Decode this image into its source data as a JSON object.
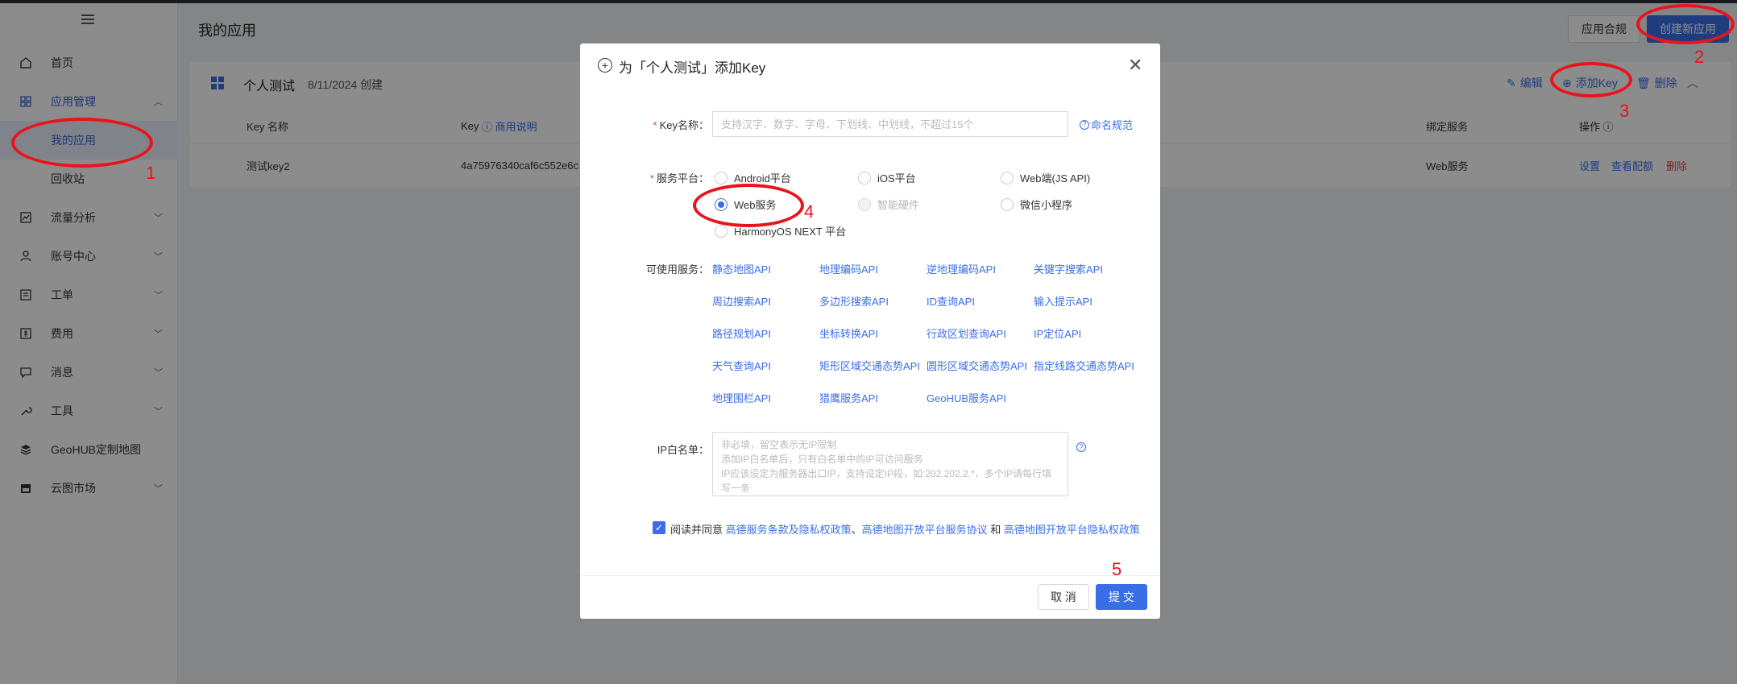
{
  "sidebar": {
    "items": [
      {
        "label": "首页",
        "icon": "home-icon"
      },
      {
        "label": "应用管理",
        "icon": "grid-icon"
      },
      {
        "label": "我的应用"
      },
      {
        "label": "回收站"
      },
      {
        "label": "流量分析",
        "icon": "chart-icon"
      },
      {
        "label": "账号中心",
        "icon": "user-icon"
      },
      {
        "label": "工单",
        "icon": "ticket-icon"
      },
      {
        "label": "费用",
        "icon": "wallet-icon"
      },
      {
        "label": "消息",
        "icon": "message-icon"
      },
      {
        "label": "工具",
        "icon": "wrench-icon"
      },
      {
        "label": "GeoHUB定制地图",
        "icon": "layers-icon"
      },
      {
        "label": "云图市场",
        "icon": "store-icon"
      }
    ]
  },
  "header": {
    "title": "我的应用",
    "compliance_label": "应用合规",
    "create_label": "创建新应用"
  },
  "app": {
    "name": "个人测试",
    "created": "8/11/2024 创建",
    "actions": {
      "edit": "编辑",
      "add_key": "添加Key",
      "delete": "删除"
    },
    "columns": {
      "key_name": "Key 名称",
      "key": "Key",
      "biz": "商用说明",
      "service": "绑定服务",
      "ops": "操作"
    },
    "row": {
      "key_name": "测试key2",
      "key": "4a75976340caf6c552e6c",
      "service": "Web服务",
      "settings": "设置",
      "config": "查看配额",
      "delete": "删除"
    }
  },
  "modal": {
    "title": "为「个人测试」添加Key",
    "key_name_label": "Key名称：",
    "key_name_placeholder": "支持汉字、数字、字母、下划线、中划线，不超过15个",
    "naming_rule": "命名规范",
    "platform_label": "服务平台：",
    "platforms": [
      "Android平台",
      "iOS平台",
      "Web端(JS API)",
      "Web服务",
      "智能硬件",
      "微信小程序",
      "HarmonyOS NEXT 平台"
    ],
    "selected_platform": "Web服务",
    "services_label": "可使用服务：",
    "services": [
      "静态地图API",
      "地理编码API",
      "逆地理编码API",
      "关键字搜索API",
      "周边搜索API",
      "多边形搜索API",
      "ID查询API",
      "输入提示API",
      "路径规划API",
      "坐标转换API",
      "行政区划查询API",
      "IP定位API",
      "天气查询API",
      "矩形区域交通态势API",
      "圆形区域交通态势API",
      "指定线路交通态势API",
      "地理围栏API",
      "猎鹰服务API",
      "GeoHUB服务API"
    ],
    "ip_label": "IP白名单：",
    "ip_placeholder": "非必填，留空表示无IP限制\n添加IP白名单后，只有白名单中的IP可访问服务\nIP应该设定为服务器出口IP，支持设定IP段，如:202.202.2.*，多个IP请每行填写一条",
    "agree_prefix": "阅读并同意",
    "agree_link1": "高德服务条款及隐私权政策",
    "agree_sep1": "、",
    "agree_link2": "高德地图开放平台服务协议",
    "agree_sep2": " 和 ",
    "agree_link3": "高德地图开放平台隐私权政策",
    "cancel_label": "取 消",
    "submit_label": "提 交"
  },
  "annotations": [
    "1",
    "2",
    "3",
    "4",
    "5"
  ],
  "colors": {
    "accent": "#3a6ee6",
    "annotation": "#e8141b",
    "danger": "#e04040"
  }
}
